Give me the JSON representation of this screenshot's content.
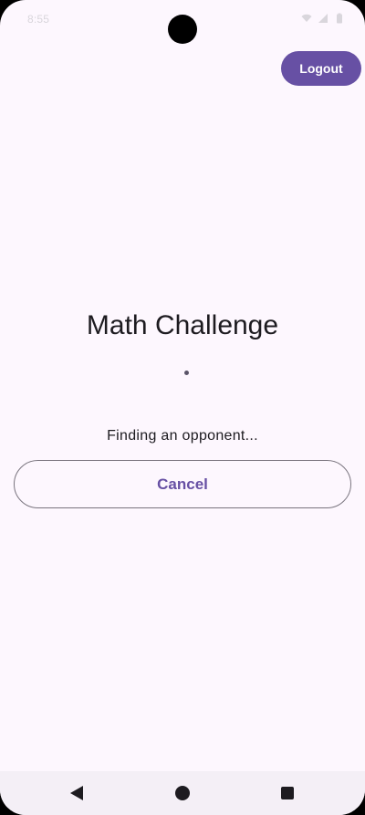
{
  "status_bar": {
    "time": "8:55",
    "icons": [
      "wifi-icon",
      "signal-icon",
      "battery-icon"
    ]
  },
  "header": {
    "logout_label": "Logout"
  },
  "main": {
    "title": "Math Challenge",
    "status_text": "Finding an opponent...",
    "cancel_label": "Cancel"
  },
  "nav_bar": {
    "icons": [
      "back-icon",
      "home-icon",
      "recents-icon"
    ]
  },
  "colors": {
    "background": "#fdf7fe",
    "primary": "#6750a4",
    "on_primary": "#ffffff",
    "text": "#1d1b20",
    "outline": "#79747e"
  }
}
